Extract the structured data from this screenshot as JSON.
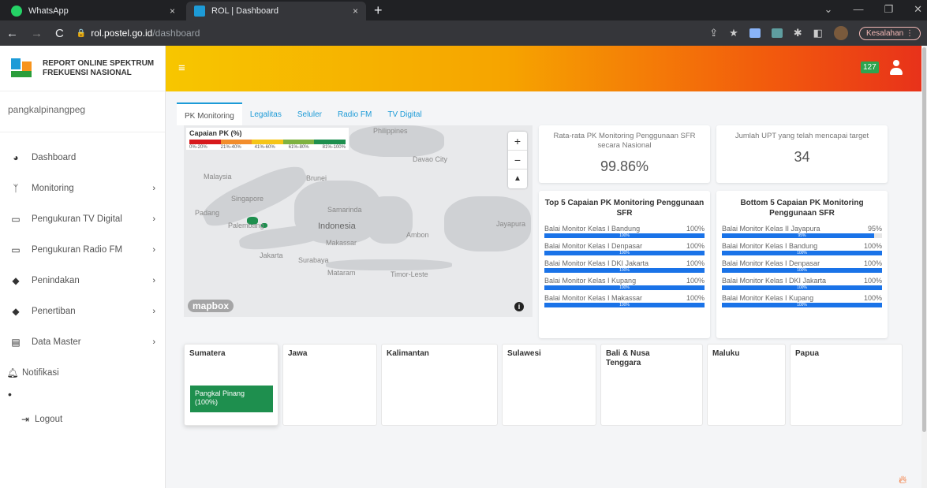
{
  "browser": {
    "tabs": [
      {
        "title": "WhatsApp",
        "close": "×",
        "icon_color": "#25d366"
      },
      {
        "title": "ROL | Dashboard",
        "close": "×",
        "icon_color": "#1d9bd7"
      }
    ],
    "new_tab": "+",
    "window_controls": [
      "⌄",
      "—",
      "❐",
      "✕"
    ],
    "url_host": "rol.postel.go.id",
    "url_path": "/dashboard",
    "profile_button": "Kesalahan ⋮"
  },
  "brand": {
    "line1": "REPORT ONLINE SPEKTRUM",
    "line2": "FREKUENSI NASIONAL"
  },
  "sidebar": {
    "username": "pangkalpinangpeg",
    "items": [
      {
        "label": "Dashboard",
        "icon": "tachometer-icon",
        "glyph": "◕",
        "chevron": false
      },
      {
        "label": "Monitoring",
        "icon": "antenna-icon",
        "glyph": "ᛉ",
        "chevron": true
      },
      {
        "label": "Pengukuran TV Digital",
        "icon": "monitor-icon",
        "glyph": "▭",
        "chevron": true
      },
      {
        "label": "Pengukuran Radio FM",
        "icon": "monitor-icon",
        "glyph": "▭",
        "chevron": true
      },
      {
        "label": "Penindakan",
        "icon": "shield-icon",
        "glyph": "◆",
        "chevron": true
      },
      {
        "label": "Penertiban",
        "icon": "shield-icon",
        "glyph": "◆",
        "chevron": true
      },
      {
        "label": "Data Master",
        "icon": "database-icon",
        "glyph": "▤",
        "chevron": true
      }
    ],
    "notifikasi": "Notifikasi",
    "logout": "Logout"
  },
  "header": {
    "menu_glyph": "≡",
    "notif_count": "127"
  },
  "subtabs": [
    "PK Monitoring",
    "Legalitas",
    "Seluler",
    "Radio FM",
    "TV Digital"
  ],
  "map": {
    "legend_title": "Capaian PK (%)",
    "legend_ranges": [
      "0%-20%",
      "21%-40%",
      "41%-60%",
      "61%-80%",
      "81%-100%"
    ],
    "legend_colors": [
      "#d7191c",
      "#f28d2c",
      "#f5c518",
      "#7fb241",
      "#1e8f4e"
    ],
    "labels": [
      "Philippines",
      "Davao City",
      "Malaysia",
      "Brunei",
      "Singapore",
      "Padang",
      "Palembang",
      "Indonesia",
      "Samarinda",
      "Makassar",
      "Ambon",
      "Jayapura",
      "Jakarta",
      "Surabaya",
      "Mataram",
      "Timor-Leste"
    ],
    "mapbox": "mapbox",
    "zoom_in": "+",
    "zoom_out": "−",
    "compass": "▲"
  },
  "stats": [
    {
      "title": "Rata-rata PK Monitoring Penggunaan SFR secara Nasional",
      "value": "99.86%"
    },
    {
      "title": "Jumlah UPT yang telah mencapai target",
      "value": "34"
    }
  ],
  "top5": {
    "title": "Top 5 Capaian PK Monitoring Penggunaan SFR",
    "rows": [
      {
        "name": "Balai Monitor Kelas I Bandung",
        "pct": 100,
        "label": "100%"
      },
      {
        "name": "Balai Monitor Kelas I Denpasar",
        "pct": 100,
        "label": "100%"
      },
      {
        "name": "Balai Monitor Kelas I DKI Jakarta",
        "pct": 100,
        "label": "100%"
      },
      {
        "name": "Balai Monitor Kelas I Kupang",
        "pct": 100,
        "label": "100%"
      },
      {
        "name": "Balai Monitor Kelas I Makassar",
        "pct": 100,
        "label": "100%"
      }
    ]
  },
  "bottom5": {
    "title": "Bottom 5 Capaian PK Monitoring Penggunaan SFR",
    "rows": [
      {
        "name": "Balai Monitor Kelas II Jayapura",
        "pct": 95,
        "label": "95%"
      },
      {
        "name": "Balai Monitor Kelas I Bandung",
        "pct": 100,
        "label": "100%"
      },
      {
        "name": "Balai Monitor Kelas I Denpasar",
        "pct": 100,
        "label": "100%"
      },
      {
        "name": "Balai Monitor Kelas I DKI Jakarta",
        "pct": 100,
        "label": "100%"
      },
      {
        "name": "Balai Monitor Kelas I Kupang",
        "pct": 100,
        "label": "100%"
      }
    ]
  },
  "regions": [
    {
      "name": "Sumatera",
      "chip": "Pangkal Pinang (100%)"
    },
    {
      "name": "Jawa"
    },
    {
      "name": "Kalimantan"
    },
    {
      "name": "Sulawesi"
    },
    {
      "name": "Bali & Nusa Tenggara"
    },
    {
      "name": "Maluku"
    },
    {
      "name": "Papua"
    }
  ]
}
